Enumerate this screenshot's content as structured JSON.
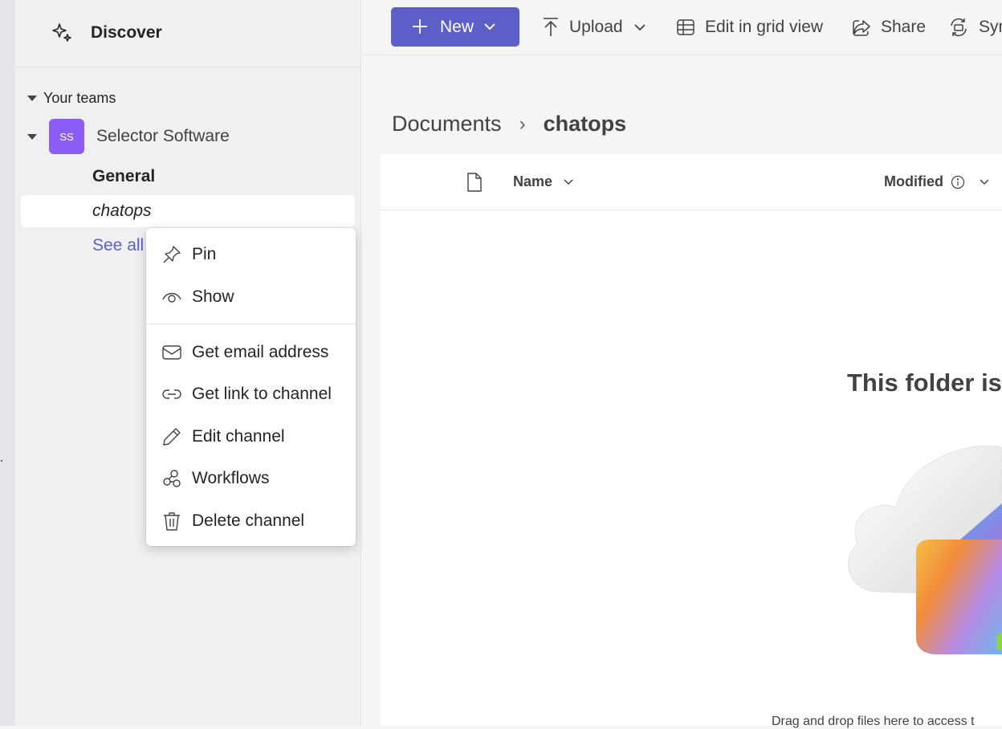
{
  "sidebar": {
    "discover_label": "Discover",
    "your_teams_label": "Your teams",
    "team": {
      "initials": "SS",
      "name": "Selector Software",
      "avatar_color": "#8b5cf6"
    },
    "channels": [
      {
        "name": "General"
      },
      {
        "name": "chatops"
      }
    ],
    "see_all_label": "See all"
  },
  "toolbar": {
    "new_label": "New",
    "upload_label": "Upload",
    "grid_label": "Edit in grid view",
    "share_label": "Share",
    "sync_label": "Syn"
  },
  "breadcrumb": {
    "parent": "Documents",
    "current": "chatops"
  },
  "columns": {
    "name": "Name",
    "modified": "Modified"
  },
  "empty_state": {
    "title": "This folder is e",
    "hint": "Drag and drop files here to access t"
  },
  "context_menu": {
    "items": [
      {
        "label": "Pin",
        "icon": "pin-icon"
      },
      {
        "label": "Show",
        "icon": "eye-icon"
      },
      {
        "label": "Get email address",
        "icon": "mail-icon"
      },
      {
        "label": "Get link to channel",
        "icon": "link-icon"
      },
      {
        "label": "Edit channel",
        "icon": "pencil-icon"
      },
      {
        "label": "Workflows",
        "icon": "workflows-icon"
      },
      {
        "label": "Delete channel",
        "icon": "trash-icon"
      }
    ]
  },
  "colors": {
    "accent": "#5b5fc7",
    "link": "#5b5fc7"
  }
}
